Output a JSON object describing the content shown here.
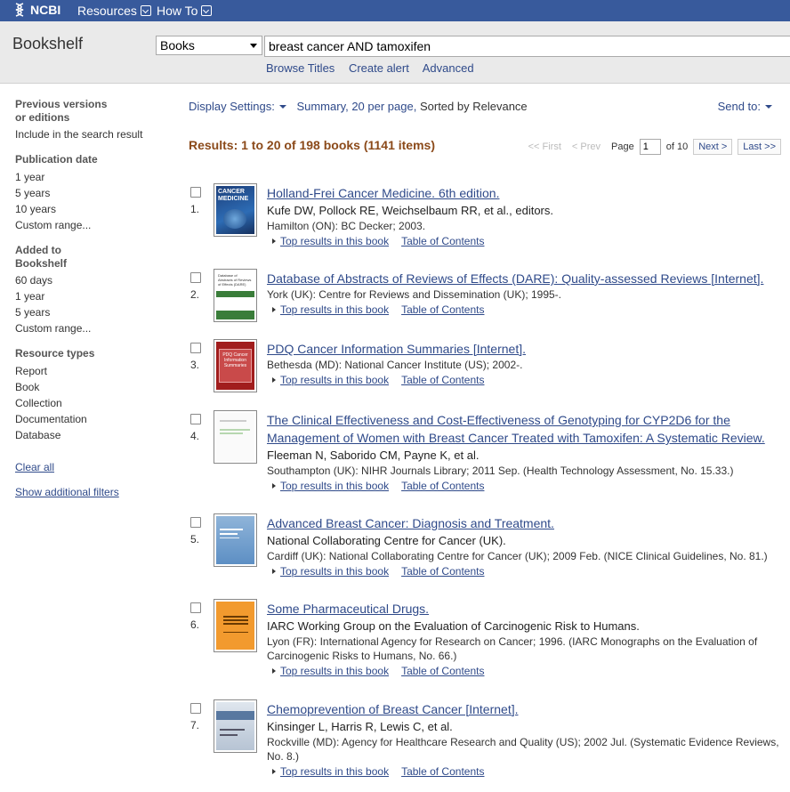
{
  "topbar": {
    "logo": "NCBI",
    "resources": "Resources",
    "howto": "How To"
  },
  "header": {
    "title": "Bookshelf",
    "db_select": "Books",
    "query": "breast cancer AND tamoxifen",
    "browse": "Browse Titles",
    "alert": "Create alert",
    "advanced": "Advanced"
  },
  "sidebar": {
    "prev_title_1": "Previous versions",
    "prev_title_2": "or editions",
    "prev_item": "Include in the search result",
    "pubdate_title": "Publication date",
    "pubdate": [
      "1 year",
      "5 years",
      "10 years",
      "Custom range..."
    ],
    "added_title_1": "Added to",
    "added_title_2": "Bookshelf",
    "added": [
      "60 days",
      "1 year",
      "5 years",
      "Custom range..."
    ],
    "restype_title": "Resource types",
    "restype": [
      "Report",
      "Book",
      "Collection",
      "Documentation",
      "Database"
    ],
    "clear_all": "Clear all",
    "show_filters": "Show additional filters"
  },
  "display": {
    "settings": "Display Settings:",
    "summary": "Summary, 20 per page,",
    "sorted": "Sorted by Relevance",
    "send_to": "Send to:"
  },
  "results_count": "Results: 1 to 20 of 198 books (1141 items)",
  "pager": {
    "first": "<< First",
    "prev": "< Prev",
    "page_label": "Page",
    "page_value": "1",
    "of": "of 10",
    "next": "Next >",
    "last": "Last >>"
  },
  "links": {
    "top": "Top results in this book",
    "toc": "Table of Contents"
  },
  "results": [
    {
      "num": "1.",
      "title": "Holland-Frei Cancer Medicine. 6th edition.",
      "authors": "Kufe DW, Pollock RE, Weichselbaum RR, et al., editors.",
      "source": "Hamilton (ON): BC Decker; 2003."
    },
    {
      "num": "2.",
      "title": "Database of Abstracts of Reviews of Effects (DARE): Quality-assessed Reviews [Internet].",
      "authors": "",
      "source": "York (UK): Centre for Reviews and Dissemination (UK); 1995-."
    },
    {
      "num": "3.",
      "title": "PDQ Cancer Information Summaries [Internet].",
      "authors": "",
      "source": "Bethesda (MD): National Cancer Institute (US); 2002-."
    },
    {
      "num": "4.",
      "title": "The Clinical Effectiveness and Cost-Effectiveness of Genotyping for CYP2D6 for the Management of Women with Breast Cancer Treated with Tamoxifen: A Systematic Review.",
      "authors": "Fleeman N, Saborido CM, Payne K, et al.",
      "source": "Southampton (UK): NIHR Journals Library; 2011 Sep. (Health Technology Assessment, No. 15.33.)"
    },
    {
      "num": "5.",
      "title": "Advanced Breast Cancer: Diagnosis and Treatment.",
      "authors": "National Collaborating Centre for Cancer (UK).",
      "source": "Cardiff (UK): National Collaborating Centre for Cancer (UK); 2009 Feb. (NICE Clinical Guidelines, No. 81.)"
    },
    {
      "num": "6.",
      "title": "Some Pharmaceutical Drugs.",
      "authors": "IARC Working Group on the Evaluation of Carcinogenic Risk to Humans.",
      "source": "Lyon (FR): International Agency for Research on Cancer; 1996. (IARC Monographs on the Evaluation of Carcinogenic Risks to Humans, No. 66.)"
    },
    {
      "num": "7.",
      "title": "Chemoprevention of Breast Cancer [Internet].",
      "authors": "Kinsinger L, Harris R, Lewis C, et al.",
      "source": "Rockville (MD): Agency for Healthcare Research and Quality (US); 2002 Jul. (Systematic Evidence Reviews, No. 8.)"
    }
  ],
  "thumb_text": {
    "t1": "CANCER MEDICINE",
    "t2": "Database of Abstracts of Reviews of Effects (DARE)",
    "t3": "PDQ Cancer Information Summaries"
  },
  "colors": {
    "topbar": "#385a9c",
    "link": "#2f4a8a",
    "results_count": "#8b4a1a"
  }
}
